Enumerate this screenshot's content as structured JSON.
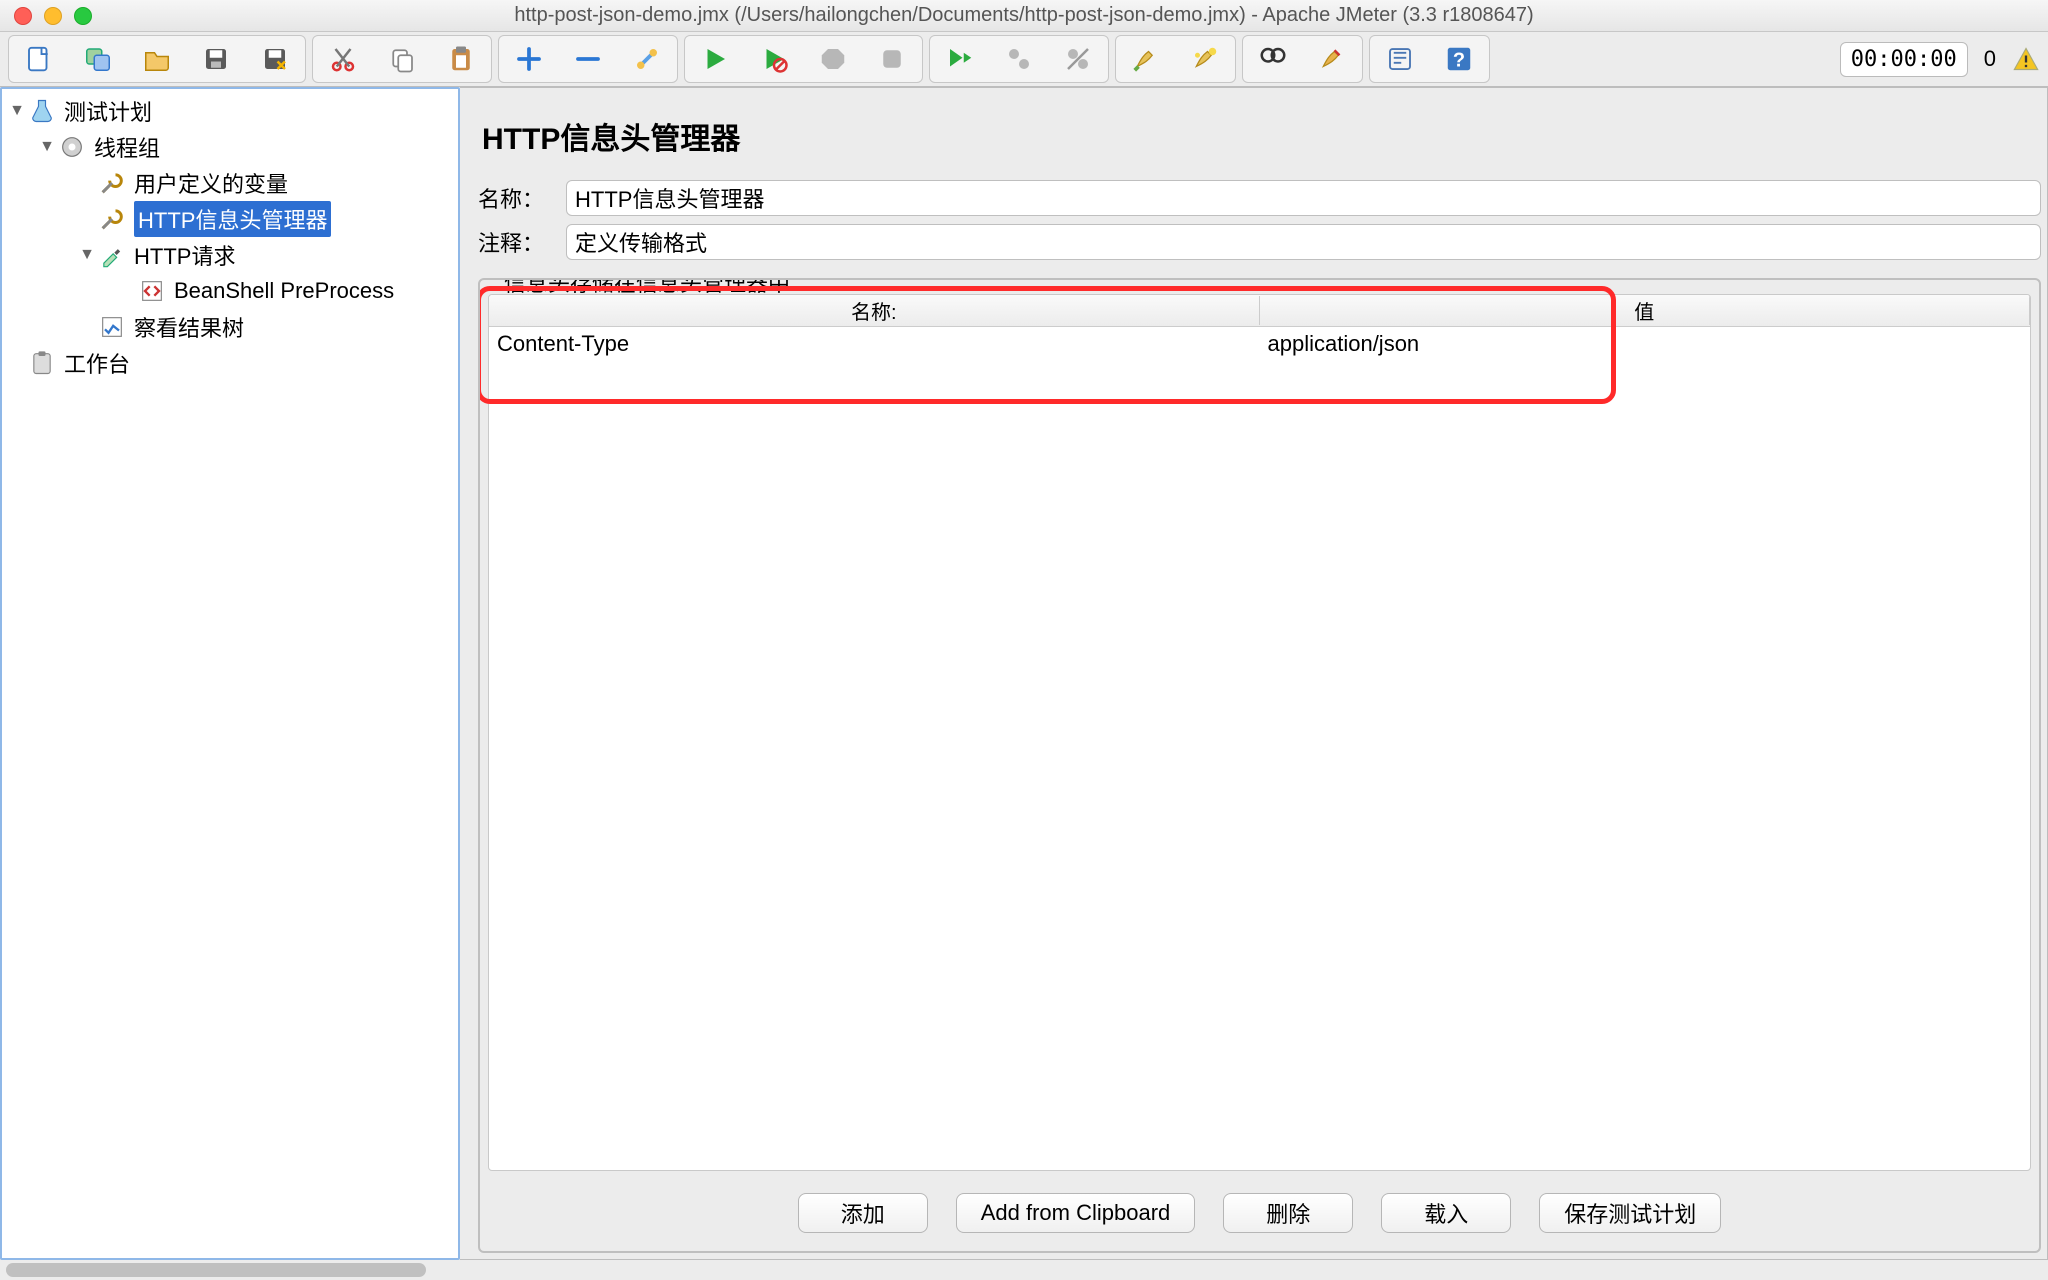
{
  "window": {
    "title": "http-post-json-demo.jmx (/Users/hailongchen/Documents/http-post-json-demo.jmx) - Apache JMeter (3.3 r1808647)"
  },
  "timer": {
    "value": "00:00:00",
    "threads": "0"
  },
  "tree": {
    "root": "测试计划",
    "threadgroup": "线程组",
    "uservars": "用户定义的变量",
    "headermgr": "HTTP信息头管理器",
    "httpreq": "HTTP请求",
    "beanshell": "BeanShell PreProcess",
    "viewtree": "察看结果树",
    "workbench": "工作台"
  },
  "editor": {
    "title": "HTTP信息头管理器",
    "name_label": "名称：",
    "name_value": "HTTP信息头管理器",
    "comment_label": "注释：",
    "comment_value": "定义传输格式",
    "fieldset_legend": "信息头存储在信息头管理器中",
    "columns": {
      "name": "名称:",
      "value": "值"
    },
    "rows": [
      {
        "name": "Content-Type",
        "value": "application/json"
      }
    ],
    "buttons": {
      "add": "添加",
      "clipboard": "Add from Clipboard",
      "delete": "删除",
      "load": "载入",
      "save": "保存测试计划"
    }
  }
}
